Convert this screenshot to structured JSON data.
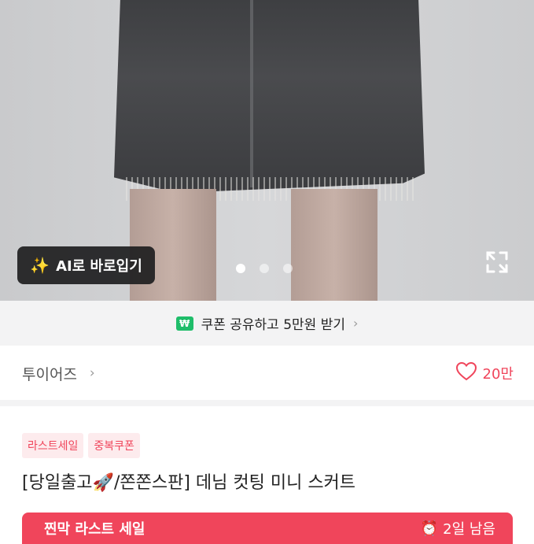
{
  "hero": {
    "ai_button_label": "AI로 바로입기",
    "ai_icon": "magic-wand-icon",
    "carousel_total": 3,
    "carousel_active": 1,
    "expand_icon": "expand-icon"
  },
  "coupon": {
    "icon_text": "₩",
    "label": "쿠폰 공유하고 5만원 받기",
    "chevron": "›"
  },
  "store": {
    "name": "투이어즈",
    "chevron": "›",
    "likes": "20만"
  },
  "badges": [
    "라스트세일",
    "중복쿠폰"
  ],
  "product": {
    "title_prefix": "[당일출고",
    "title_emoji": "🚀",
    "title_suffix": "/쫀쫀스판] 데님 컷팅 미니 스커트"
  },
  "sale_banner": {
    "label": "찐막 라스트 세일",
    "timer": "2일 남음"
  },
  "colors": {
    "accent": "#f0455b",
    "coupon_green": "#1fbd6a"
  }
}
